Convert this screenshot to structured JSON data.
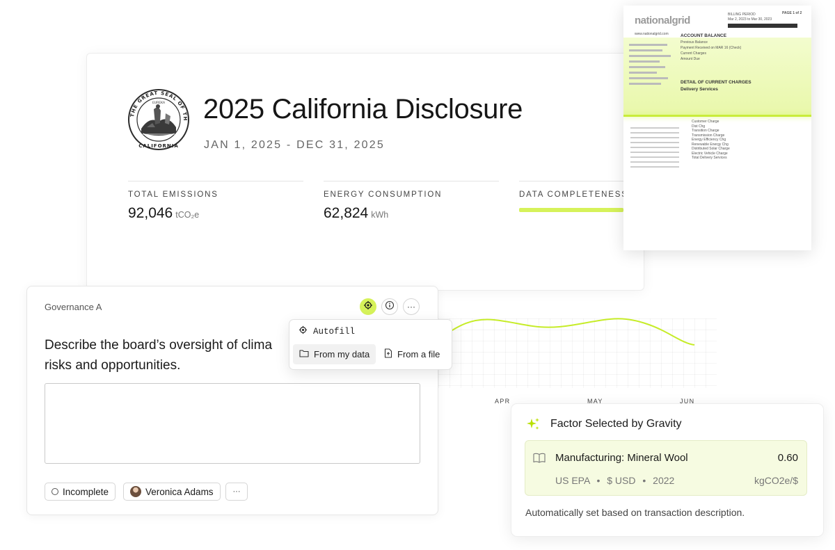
{
  "disclosure": {
    "seal_text": "THE GREAT SEAL OF THE STATE OF CALIFORNIA",
    "seal_motto": "EUREKA",
    "title": "2025 California Disclosure",
    "date_range": "JAN 1, 2025 - DEC 31, 2025",
    "metrics": [
      {
        "label": "TOTAL EMISSIONS",
        "value": "92,046",
        "unit": "tCO₂e"
      },
      {
        "label": "ENERGY CONSUMPTION",
        "value": "62,824",
        "unit": "kWh"
      },
      {
        "label": "DATA COMPLETENESS",
        "progress": 0.6
      }
    ]
  },
  "bill": {
    "logo": "nationalgrid",
    "sections": {
      "account_balance": "ACCOUNT BALANCE",
      "current_charges": "DETAIL OF CURRENT CHARGES",
      "delivery_services": "Delivery Services"
    },
    "lines": [
      "Previous Balance",
      "Payment Received on MAR 16 (Check)",
      "Current Charges",
      "Amount Due",
      "Customer Charge",
      "Dist Chg",
      "Transition Charge",
      "Transmission Charge",
      "Energy Efficiency Chg",
      "Renewable Energy Chg",
      "Distributed Solar Charge",
      "Electric Vehicle Charge",
      "Total Delivery Services"
    ]
  },
  "chart": {
    "months": [
      "APR",
      "MAY",
      "JUN"
    ],
    "line_color": "#c6ec28"
  },
  "governance": {
    "label": "Governance A",
    "question": "Describe the board’s oversight of clima",
    "question_line2": "risks and opportunities.",
    "answer": "",
    "status": "Incomplete",
    "assignee": "Veronica Adams",
    "more": "···"
  },
  "autofill": {
    "title": "Autofill",
    "options": [
      "From my data",
      "From a file"
    ]
  },
  "factor": {
    "title": "Factor Selected by Gravity",
    "name": "Manufacturing: Mineral Wool",
    "value": "0.60",
    "source": "US EPA",
    "currency": "$ USD",
    "year": "2022",
    "unit": "kgCO2e/$",
    "note": "Automatically set based on transaction description."
  },
  "colors": {
    "accent": "#d6f25a",
    "highlight": "#eefab8"
  }
}
